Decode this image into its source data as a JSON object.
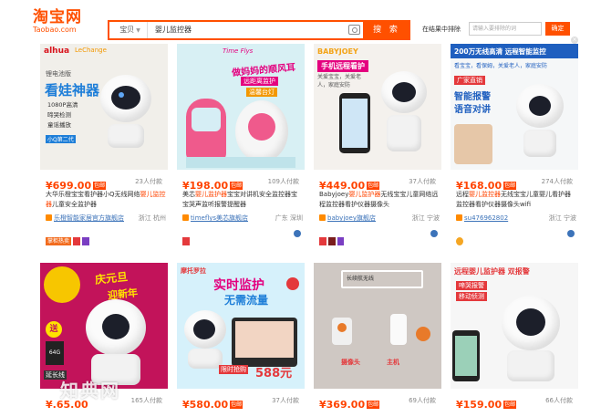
{
  "header": {
    "logo_cn": "淘宝网",
    "logo_en": "Taobao.com",
    "search_scope": "宝贝",
    "search_query": "婴儿监控器",
    "search_button": "搜 索",
    "in_result_label": "在结果中排除",
    "exclude_placeholder": "请输入要排除的词",
    "confirm_button": "确定"
  },
  "products": [
    {
      "price": "¥699.00",
      "free_ship": "包邮",
      "buyers": "23人付款",
      "title_pre": "大华乐橙宝宝看护器小Q无线网络",
      "title_hl": "婴儿监控器",
      "title_post": "儿童安全监护器",
      "shop": "乐橙智能家居官方旗舰店",
      "location": "浙江 杭州",
      "badges": [
        "掌柜热卖"
      ],
      "image_text": {
        "brand": "alhua",
        "brand2": "LeChange",
        "line1": "锂电池版",
        "headline": "看娃神器",
        "f1": "1080P高清",
        "f2": "啼哭检测",
        "f3": "童谣播放",
        "note": "小Q第二代"
      }
    },
    {
      "price": "¥198.00",
      "free_ship": "包邮",
      "buyers": "109人付款",
      "title_pre": "美芯",
      "title_hl": "婴儿监护器",
      "title_post": "宝宝对讲机安全监控器宝宝哭声监听报警提醒器",
      "shop": "timeflys美芯旗舰店",
      "location": "广东 深圳",
      "badges": [],
      "image_text": {
        "brand": "Time Flys",
        "headline": "做妈妈的顺风耳",
        "sub1": "远距离监护",
        "sub2": "温馨台灯"
      }
    },
    {
      "price": "¥449.00",
      "free_ship": "包邮",
      "buyers": "37人付款",
      "title_pre": "Babyjoey",
      "title_hl": "婴儿监护器",
      "title_post": "无线宝宝儿童网络远程监控器看护仪器摄像头",
      "shop": "babyjoey旗舰店",
      "location": "浙江 宁波",
      "badges": [],
      "image_text": {
        "brand": "BABYJOEY",
        "headline": "手机远程看护",
        "sub": "关爱宝宝，关爱老人，家庭安防"
      }
    },
    {
      "price": "¥168.00",
      "free_ship": "包邮",
      "buyers": "274人付款",
      "title_pre": "远程",
      "title_hl": "婴儿监控器",
      "title_post": "无线宝宝儿童婴儿看护器监控器看护仪器摄像头wifi",
      "shop": "su476962802",
      "location": "浙江 宁波",
      "badges": [],
      "image_text": {
        "headline": "200万无线高清 远程智能监控",
        "sub": "看宝宝，看保姆，关爱老人，家庭安防",
        "tag": "广家直销",
        "f1": "智能报警",
        "f2": "语音对讲"
      }
    },
    {
      "price": "¥.65.00",
      "free_ship": "",
      "buyers": "165人付款",
      "image_text": {
        "headline": "庆元旦",
        "sub": "迎新年",
        "badge": "送",
        "card": "64G",
        "extra": "延长线"
      }
    },
    {
      "price": "¥580.00",
      "free_ship": "包邮",
      "buyers": "37人付款",
      "image_text": {
        "brand": "摩托罗拉",
        "headline": "实时监护",
        "sub": "无需流量",
        "promo": "限时抢购",
        "promo_price": "588元"
      }
    },
    {
      "price": "¥369.00",
      "free_ship": "包邮",
      "buyers": "69人付款",
      "image_text": {
        "label": "长续航无线",
        "l1": "摄像头",
        "l2": "主机"
      }
    },
    {
      "price": "¥159.00",
      "free_ship": "包邮",
      "buyers": "66人付款",
      "image_text": {
        "headline": "远程婴儿监护器 双报警",
        "f1": "啼哭报警",
        "f2": "移动侦测"
      }
    }
  ],
  "watermark": "知典网",
  "colors": {
    "brand_orange": "#ff5000",
    "price_red": "#ff4400",
    "link_blue": "#3c73b9"
  },
  "icons": [
    "camera-icon",
    "shop-icon",
    "wangwang-icon",
    "close-icon"
  ]
}
